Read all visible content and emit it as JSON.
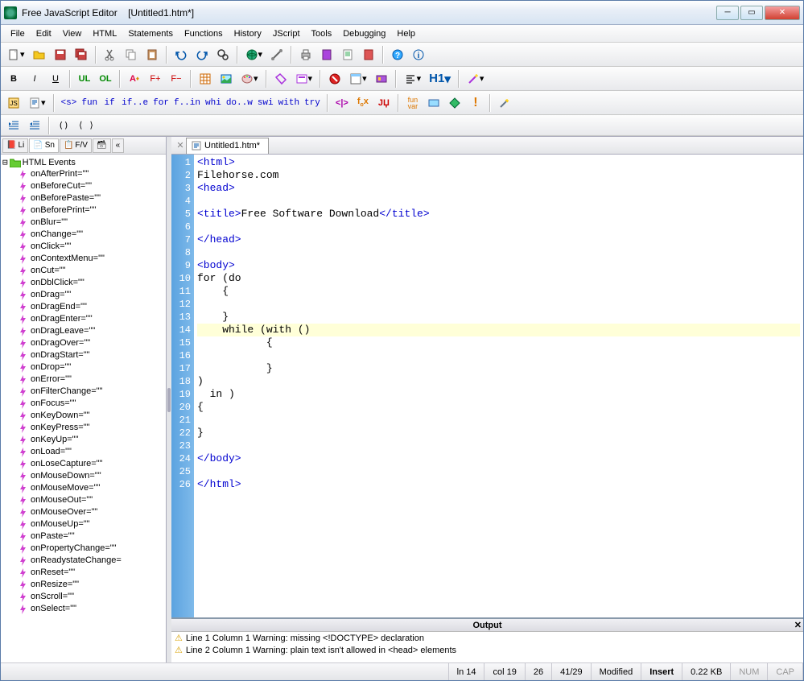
{
  "window": {
    "app": "Free JavaScript Editor",
    "file": "[Untitled1.htm*]"
  },
  "menu": [
    "File",
    "Edit",
    "View",
    "HTML",
    "Statements",
    "Functions",
    "History",
    "JScript",
    "Tools",
    "Debugging",
    "Help"
  ],
  "toolbar2": {
    "bold": "B",
    "italic": "I",
    "underline": "U",
    "ul": "UL",
    "ol": "OL",
    "fplus": "F+",
    "fminus": "F−",
    "h1": "H1"
  },
  "toolbar3_keywords": [
    "<s>",
    "fun",
    "if",
    "if..e",
    "for",
    "f..in",
    "whi",
    "do..w",
    "swi",
    "with",
    "try"
  ],
  "toolbar3_icons": [
    "eval-icon",
    "fox-icon",
    "jerror-icon",
    "fun-var-icon",
    "variable-icon",
    "diamond-icon",
    "warning-icon",
    "wand-icon"
  ],
  "sidebar_tabs": [
    "Li",
    "Sn",
    "F/V"
  ],
  "tree_root": "HTML Events",
  "tree_items": [
    "onAfterPrint=\"\"",
    "onBeforeCut=\"\"",
    "onBeforePaste=\"\"",
    "onBeforePrint=\"\"",
    "onBlur=\"\"",
    "onChange=\"\"",
    "onClick=\"\"",
    "onContextMenu=\"\"",
    "onCut=\"\"",
    "onDblClick=\"\"",
    "onDrag=\"\"",
    "onDragEnd=\"\"",
    "onDragEnter=\"\"",
    "onDragLeave=\"\"",
    "onDragOver=\"\"",
    "onDragStart=\"\"",
    "onDrop=\"\"",
    "onError=\"\"",
    "onFilterChange=\"\"",
    "onFocus=\"\"",
    "onKeyDown=\"\"",
    "onKeyPress=\"\"",
    "onKeyUp=\"\"",
    "onLoad=\"\"",
    "onLoseCapture=\"\"",
    "onMouseDown=\"\"",
    "onMouseMove=\"\"",
    "onMouseOut=\"\"",
    "onMouseOver=\"\"",
    "onMouseUp=\"\"",
    "onPaste=\"\"",
    "onPropertyChange=\"\"",
    "onReadystateChange=",
    "onReset=\"\"",
    "onResize=\"\"",
    "onScroll=\"\"",
    "onSelect=\"\""
  ],
  "editor": {
    "tab": "Untitled1.htm*",
    "current_line": 14,
    "lines": [
      {
        "n": 1,
        "html": "&lt;html&gt;",
        "cls": "tag"
      },
      {
        "n": 2,
        "html": "Filehorse.com",
        "cls": ""
      },
      {
        "n": 3,
        "html": "&lt;head&gt;",
        "cls": "tag"
      },
      {
        "n": 4,
        "html": "",
        "cls": ""
      },
      {
        "n": 5,
        "html": "&lt;title&gt;<span class=''>Free Software Download</span>&lt;/title&gt;",
        "cls": "tag"
      },
      {
        "n": 6,
        "html": "",
        "cls": ""
      },
      {
        "n": 7,
        "html": "&lt;/head&gt;",
        "cls": "tag"
      },
      {
        "n": 8,
        "html": "",
        "cls": ""
      },
      {
        "n": 9,
        "html": "&lt;body&gt;",
        "cls": "tag"
      },
      {
        "n": 10,
        "html": "for (do",
        "cls": ""
      },
      {
        "n": 11,
        "html": "    {",
        "cls": ""
      },
      {
        "n": 12,
        "html": "",
        "cls": ""
      },
      {
        "n": 13,
        "html": "    }",
        "cls": ""
      },
      {
        "n": 14,
        "html": "    while (with ()",
        "cls": ""
      },
      {
        "n": 15,
        "html": "           {",
        "cls": ""
      },
      {
        "n": 16,
        "html": "",
        "cls": ""
      },
      {
        "n": 17,
        "html": "           }",
        "cls": ""
      },
      {
        "n": 18,
        "html": ")",
        "cls": ""
      },
      {
        "n": 19,
        "html": "  in )",
        "cls": ""
      },
      {
        "n": 20,
        "html": "{",
        "cls": ""
      },
      {
        "n": 21,
        "html": "",
        "cls": ""
      },
      {
        "n": 22,
        "html": "}",
        "cls": ""
      },
      {
        "n": 23,
        "html": "",
        "cls": ""
      },
      {
        "n": 24,
        "html": "&lt;/body&gt;",
        "cls": "tag"
      },
      {
        "n": 25,
        "html": "",
        "cls": ""
      },
      {
        "n": 26,
        "html": "&lt;/html&gt;",
        "cls": "tag"
      }
    ]
  },
  "output": {
    "title": "Output",
    "lines": [
      "Line 1 Column 1  Warning: missing <!DOCTYPE> declaration",
      "Line 2 Column 1  Warning: plain text isn't allowed in <head> elements"
    ]
  },
  "status": {
    "line": "ln 14",
    "col": "col 19",
    "count": "26",
    "pos": "41/29",
    "modified": "Modified",
    "insert": "Insert",
    "size": "0.22 KB",
    "num": "NUM",
    "cap": "CAP"
  }
}
